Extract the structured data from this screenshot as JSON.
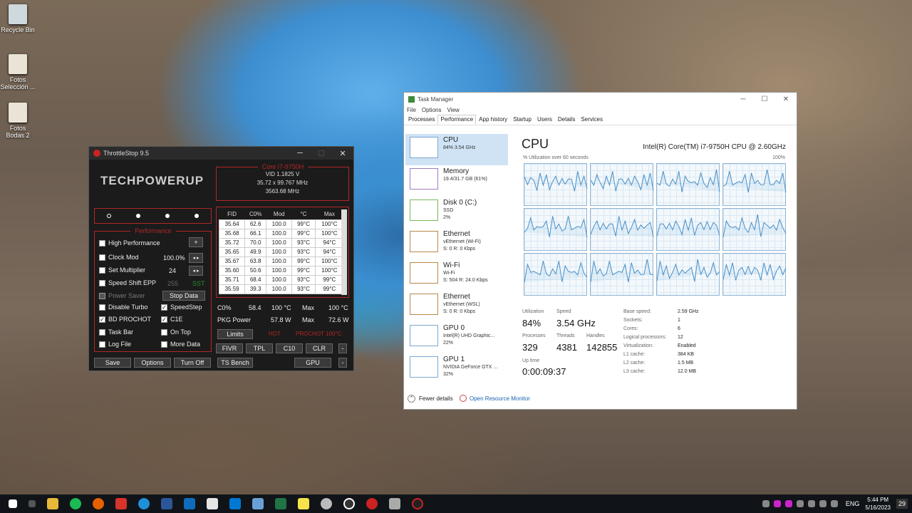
{
  "desktop": {
    "icons": [
      {
        "label": "Recycle Bin"
      },
      {
        "label": "Fotos Selección ..."
      },
      {
        "label": "Fotos Bodas 2"
      }
    ]
  },
  "throttlestop": {
    "title": "ThrottleStop 9.5",
    "logo_text": "TECHPOWERUP",
    "cpu_name": "Core i7-9750H",
    "vid": "VID  1.1825 V",
    "multiplier": "35.72 x 99.767 MHz",
    "freq": "3563.68 MHz",
    "performance_label": "Performance",
    "options": {
      "high_performance": "High Performance",
      "clock_mod": "Clock Mod",
      "clock_mod_value": "100.0%",
      "set_multiplier": "Set Multiplier",
      "set_multiplier_value": "24",
      "speed_shift": "Speed Shift EPP",
      "speed_shift_value": "255",
      "sst": "SST",
      "power_saver": "Power Saver",
      "stop_data": "Stop Data",
      "disable_turbo": "Disable Turbo",
      "speedstep": "SpeedStep",
      "bd_prochot": "BD PROCHOT",
      "c1e": "C1E",
      "task_bar": "Task Bar",
      "on_top": "On Top",
      "log_file": "Log File",
      "more_data": "More Data",
      "plus": "+"
    },
    "table": {
      "headers": [
        "FID",
        "C0%",
        "Mod",
        "°C",
        "Max"
      ],
      "rows": [
        [
          "35.64",
          "62.6",
          "100.0",
          "99°C",
          "100°C"
        ],
        [
          "35.68",
          "66.1",
          "100.0",
          "99°C",
          "100°C"
        ],
        [
          "35.72",
          "70.0",
          "100.0",
          "93°C",
          "94°C"
        ],
        [
          "35.65",
          "49.9",
          "100.0",
          "93°C",
          "94°C"
        ],
        [
          "35.67",
          "63.8",
          "100.0",
          "99°C",
          "100°C"
        ],
        [
          "35.60",
          "50.6",
          "100.0",
          "99°C",
          "100°C"
        ],
        [
          "35.71",
          "68.4",
          "100.0",
          "93°C",
          "99°C"
        ],
        [
          "35.59",
          "39.3",
          "100.0",
          "93°C",
          "99°C"
        ]
      ]
    },
    "c0": {
      "label": "C0%",
      "value": "58.4",
      "temp": "100 °C",
      "max_label": "Max",
      "max_value": "100 °C"
    },
    "pkg": {
      "label": "PKG Power",
      "value": "57.8 W",
      "max_label": "Max",
      "max_value": "72.6 W"
    },
    "limits": "Limits",
    "hot": "HOT",
    "prochot": "PROCHOT 100°C",
    "buttons": {
      "fivr": "FIVR",
      "tpl": "TPL",
      "c10": "C10",
      "clr": "CLR",
      "minus": "-",
      "save": "Save",
      "options": "Options",
      "turn_off": "Turn Off",
      "ts_bench": "TS Bench",
      "gpu": "GPU"
    }
  },
  "taskmanager": {
    "title": "Task Manager",
    "menu": [
      "File",
      "Options",
      "View"
    ],
    "tabs": [
      "Processes",
      "Performance",
      "App history",
      "Startup",
      "Users",
      "Details",
      "Services"
    ],
    "sidebar": [
      {
        "name": "CPU",
        "sub1": "84% 3.54 GHz",
        "sub2": ""
      },
      {
        "name": "Memory",
        "sub1": "19.4/31.7 GB (61%)",
        "sub2": ""
      },
      {
        "name": "Disk 0 (C:)",
        "sub1": "SSD",
        "sub2": "2%"
      },
      {
        "name": "Ethernet",
        "sub1": "vEthernet (Wi-Fi)",
        "sub2": "S: 0 R: 0 Kbps"
      },
      {
        "name": "Wi-Fi",
        "sub1": "Wi-Fi",
        "sub2": "S: 504 R: 24.0 Kbps"
      },
      {
        "name": "Ethernet",
        "sub1": "vEthernet (WSL)",
        "sub2": "S: 0 R: 0 Kbps"
      },
      {
        "name": "GPU 0",
        "sub1": "Intel(R) UHD Graphic...",
        "sub2": "22%"
      },
      {
        "name": "GPU 1",
        "sub1": "NVIDIA GeForce GTX ...",
        "sub2": "32%"
      }
    ],
    "cpu_heading": "CPU",
    "cpu_model": "Intel(R) Core(TM) i7-9750H CPU @ 2.60GHz",
    "util_label": "% Utilization over 60 seconds",
    "util_max": "100%",
    "stats": {
      "utilization_label": "Utilization",
      "utilization": "84%",
      "speed_label": "Speed",
      "speed": "3.54 GHz",
      "processes_label": "Processes",
      "processes": "329",
      "threads_label": "Threads",
      "threads": "4381",
      "handles_label": "Handles",
      "handles": "142855",
      "uptime_label": "Up time",
      "uptime": "0:00:09:37"
    },
    "specs": [
      {
        "k": "Base speed:",
        "v": "2.59 GHz"
      },
      {
        "k": "Sockets:",
        "v": "1"
      },
      {
        "k": "Cores:",
        "v": "6"
      },
      {
        "k": "Logical processors:",
        "v": "12"
      },
      {
        "k": "Virtualization:",
        "v": "Enabled"
      },
      {
        "k": "L1 cache:",
        "v": "384 KB"
      },
      {
        "k": "L2 cache:",
        "v": "1.5 MB"
      },
      {
        "k": "L3 cache:",
        "v": "12.0 MB"
      }
    ],
    "fewer_details": "Fewer details",
    "open_monitor": "Open Resource Monitor"
  },
  "taskbar": {
    "lang": "ENG",
    "time": "5:44 PM",
    "date": "5/16/2023",
    "notif": "29"
  }
}
